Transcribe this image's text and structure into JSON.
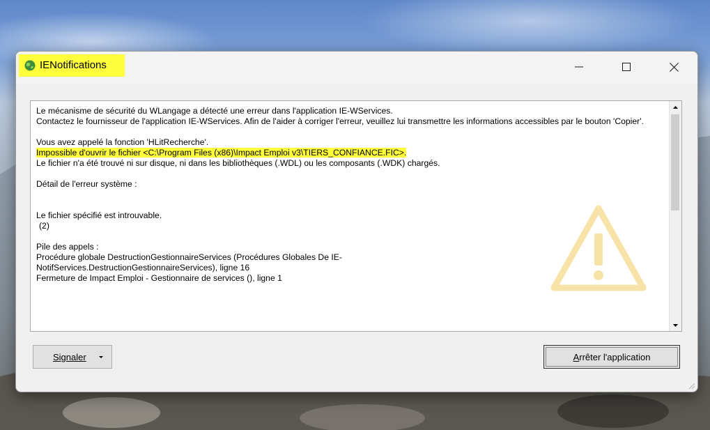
{
  "window": {
    "title": "IENotifications",
    "icon": "globe-icon"
  },
  "title_controls": {
    "minimize": "minimize-icon",
    "maximize": "maximize-icon",
    "close": "close-icon"
  },
  "message": {
    "lines": [
      "Le mécanisme de sécurité du WLangage a détecté une erreur dans l'application IE-WServices.",
      "Contactez le fournisseur de l'application IE-WServices. Afin de l'aider à corriger l'erreur, veuillez lui transmettre les informations accessibles par le bouton 'Copier'.",
      "Vous avez appelé la fonction 'HLitRecherche'.",
      "Impossible d'ouvrir le fichier <C:\\Program Files (x86)\\Impact Emploi v3\\TIERS_CONFIANCE.FIC>.",
      "Le fichier n'a été trouvé ni sur disque, ni dans les bibliothèques (.WDL) ou les composants (.WDK) chargés.",
      "Détail de l'erreur système :",
      "Le fichier spécifié est introuvable.",
      "(2)",
      "Pile des appels :",
      "Procédure globale DestructionGestionnaireServices (Procédures Globales De IE-NotifServices.DestructionGestionnaireServices), ligne 16",
      "Fermeture de Impact Emploi - Gestionnaire de services (), ligne 1"
    ],
    "highlight_color": "#ffff3b",
    "watermark_icon": "warning-icon"
  },
  "buttons": {
    "report_label": "Signaler",
    "stop_label_accel": "A",
    "stop_label_rest": "rrêter l'application"
  },
  "colors": {
    "highlight": "#ffff3b",
    "warning_watermark": "#f6d98a"
  }
}
